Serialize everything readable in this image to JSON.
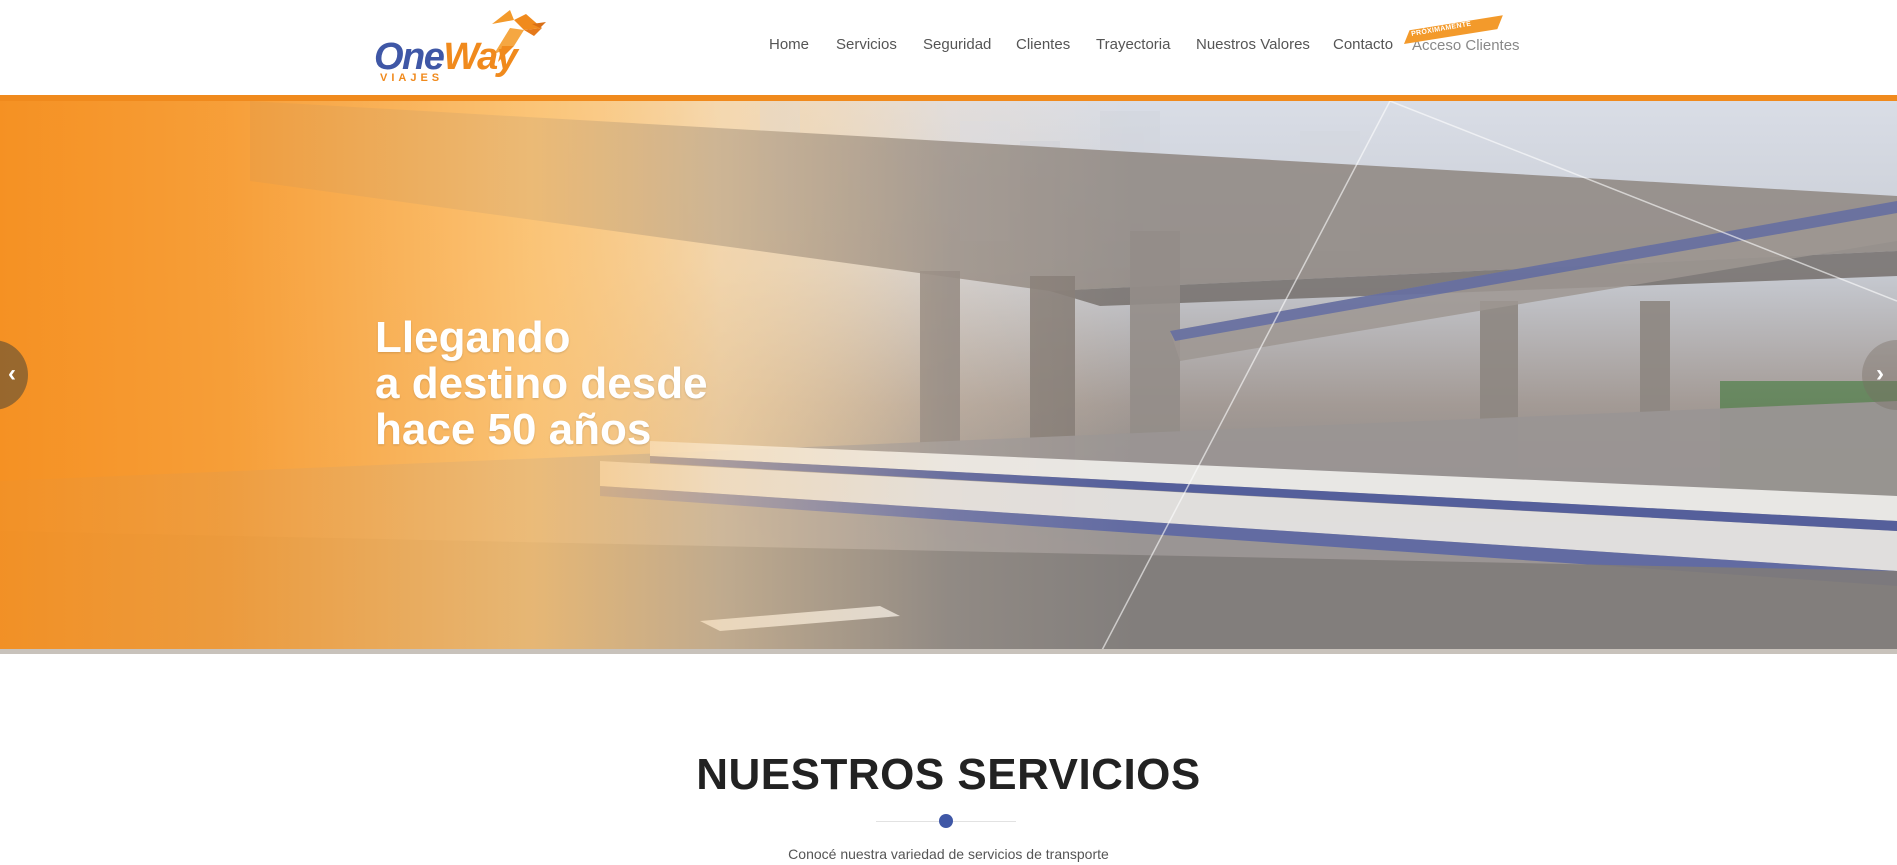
{
  "brand": {
    "name_part1": "One",
    "name_part2": "Way",
    "subtitle": "VIAJES",
    "logo_icon": "bird-icon",
    "colors": {
      "orange": "#f08a1d",
      "blue": "#3f57a6"
    }
  },
  "nav": {
    "items": [
      {
        "label": "Home"
      },
      {
        "label": "Servicios"
      },
      {
        "label": "Seguridad"
      },
      {
        "label": "Clientes"
      },
      {
        "label": "Trayectoria"
      },
      {
        "label": "Nuestros Valores"
      },
      {
        "label": "Contacto"
      }
    ],
    "badge": "PRÓXIMAMENTE",
    "acceso": "Acceso Clientes"
  },
  "hero": {
    "lines": [
      "Llegando",
      "a destino desde",
      "hace 50 años"
    ],
    "prev_icon": "chevron-left-icon",
    "next_icon": "chevron-right-icon"
  },
  "services": {
    "title": "NUESTROS SERVICIOS",
    "subtitle": "Conocé nuestra variedad de servicios de transporte"
  }
}
